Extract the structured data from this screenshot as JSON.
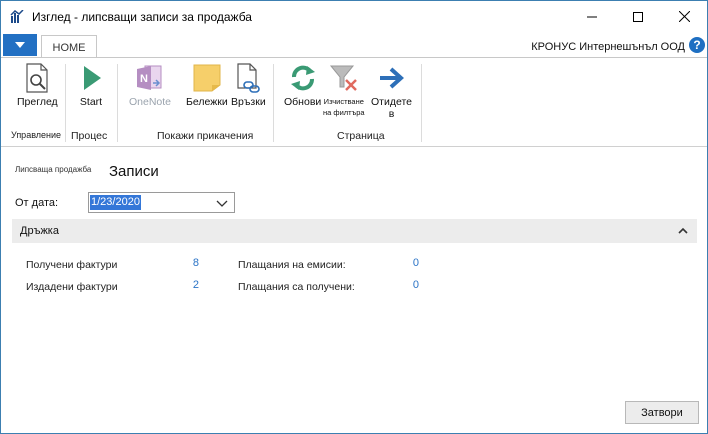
{
  "window": {
    "title": "Изглед - липсващи записи за продажба"
  },
  "ribbon": {
    "tab_home": "HOME",
    "company": "КРОНУС Интернешънъл ООД",
    "buttons": {
      "preview": "Преглед",
      "start": "Start",
      "onenote": "OneNote",
      "notes": "Бележки",
      "links": "Връзки",
      "refresh": "Обнови",
      "clear_filter_1": "Изчистване",
      "clear_filter_2": "на филтъра",
      "goto_1": "Отидете",
      "goto_2": "в"
    },
    "groups": {
      "manage": "Управление",
      "process": "Процес",
      "attachments": "Покажи прикачения",
      "page": "Страница"
    }
  },
  "page": {
    "subtitle_small": "Липсваща продажба",
    "subtitle_big": "Записи",
    "date_label": "От дата:",
    "date_value": "1/23/2020",
    "fasttab_title": "Дръжка",
    "cues": {
      "received_invoices_label": "Получени фактури",
      "received_invoices_value": "8",
      "issued_invoices_label": "Издадени фактури",
      "issued_invoices_value": "2",
      "emission_payments_label": "Плащания на емисии:",
      "emission_payments_value": "0",
      "received_payments_label": "Плащания са получени:",
      "received_payments_value": "0"
    },
    "close_button": "Затвори"
  },
  "colors": {
    "accent": "#2270c3",
    "link_value": "#2b74c7",
    "selection": "#3477d8"
  }
}
